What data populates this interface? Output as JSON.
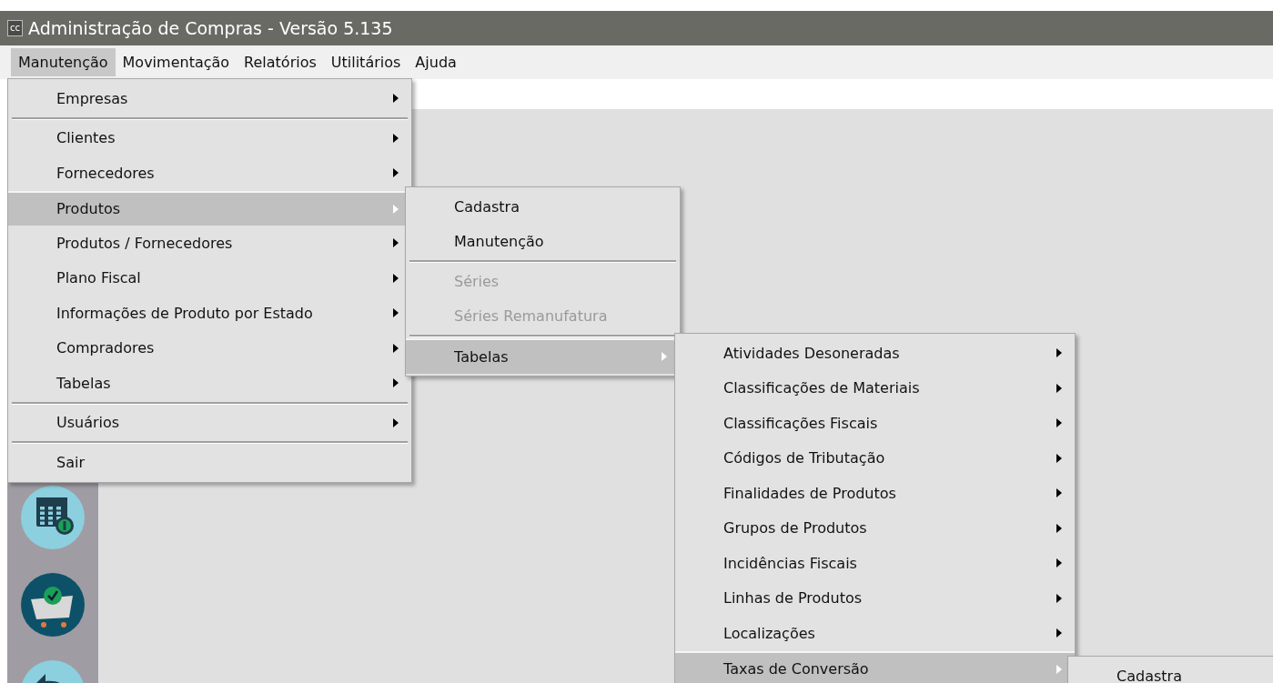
{
  "window": {
    "title": "Administração de Compras - Versão 5.135",
    "app_icon": "cc"
  },
  "menu_bar": [
    {
      "label": "Manutenção",
      "selected": true
    },
    {
      "label": "Movimentação",
      "selected": false
    },
    {
      "label": "Relatórios",
      "selected": false
    },
    {
      "label": "Utilitários",
      "selected": false
    },
    {
      "label": "Ajuda",
      "selected": false
    }
  ],
  "menus": [
    {
      "items": [
        {
          "kind": "item",
          "label": "Empresas",
          "submenu": true,
          "selected": false,
          "disabled": false
        },
        {
          "kind": "separator"
        },
        {
          "kind": "item",
          "label": "Clientes",
          "submenu": true,
          "selected": false,
          "disabled": false
        },
        {
          "kind": "item",
          "label": "Fornecedores",
          "submenu": true,
          "selected": false,
          "disabled": false
        },
        {
          "kind": "item",
          "label": "Produtos",
          "submenu": true,
          "selected": true,
          "disabled": false
        },
        {
          "kind": "item",
          "label": "Produtos / Fornecedores",
          "submenu": true,
          "selected": false,
          "disabled": false
        },
        {
          "kind": "item",
          "label": "Plano Fiscal",
          "submenu": true,
          "selected": false,
          "disabled": false
        },
        {
          "kind": "item",
          "label": "Informações de Produto por Estado",
          "submenu": true,
          "selected": false,
          "disabled": false
        },
        {
          "kind": "item",
          "label": "Compradores",
          "submenu": true,
          "selected": false,
          "disabled": false
        },
        {
          "kind": "item",
          "label": "Tabelas",
          "submenu": true,
          "selected": false,
          "disabled": false
        },
        {
          "kind": "separator"
        },
        {
          "kind": "item",
          "label": "Usuários",
          "submenu": true,
          "selected": false,
          "disabled": false
        },
        {
          "kind": "separator"
        },
        {
          "kind": "item",
          "label": "Sair",
          "submenu": false,
          "selected": false,
          "disabled": false
        }
      ]
    },
    {
      "items": [
        {
          "kind": "item",
          "label": "Cadastra",
          "submenu": false,
          "selected": false,
          "disabled": false
        },
        {
          "kind": "item",
          "label": "Manutenção",
          "submenu": false,
          "selected": false,
          "disabled": false
        },
        {
          "kind": "separator"
        },
        {
          "kind": "item",
          "label": "Séries",
          "submenu": false,
          "selected": false,
          "disabled": true
        },
        {
          "kind": "item",
          "label": "Séries Remanufatura",
          "submenu": false,
          "selected": false,
          "disabled": true
        },
        {
          "kind": "separator"
        },
        {
          "kind": "item",
          "label": "Tabelas",
          "submenu": true,
          "selected": true,
          "disabled": false
        }
      ]
    },
    {
      "items": [
        {
          "kind": "item",
          "label": "Atividades Desoneradas",
          "submenu": true,
          "selected": false,
          "disabled": false
        },
        {
          "kind": "item",
          "label": "Classificações de Materiais",
          "submenu": true,
          "selected": false,
          "disabled": false
        },
        {
          "kind": "item",
          "label": "Classificações Fiscais",
          "submenu": true,
          "selected": false,
          "disabled": false
        },
        {
          "kind": "item",
          "label": "Códigos de Tributação",
          "submenu": true,
          "selected": false,
          "disabled": false
        },
        {
          "kind": "item",
          "label": "Finalidades de Produtos",
          "submenu": true,
          "selected": false,
          "disabled": false
        },
        {
          "kind": "item",
          "label": "Grupos de Produtos",
          "submenu": true,
          "selected": false,
          "disabled": false
        },
        {
          "kind": "item",
          "label": "Incidências Fiscais",
          "submenu": true,
          "selected": false,
          "disabled": false
        },
        {
          "kind": "item",
          "label": "Linhas de Produtos",
          "submenu": true,
          "selected": false,
          "disabled": false
        },
        {
          "kind": "item",
          "label": "Localizações",
          "submenu": true,
          "selected": false,
          "disabled": false
        },
        {
          "kind": "item",
          "label": "Taxas de Conversão",
          "submenu": true,
          "selected": true,
          "disabled": false
        }
      ]
    },
    {
      "items": [
        {
          "kind": "item",
          "label": "Cadastra",
          "submenu": false,
          "selected": false,
          "disabled": false
        }
      ]
    }
  ]
}
